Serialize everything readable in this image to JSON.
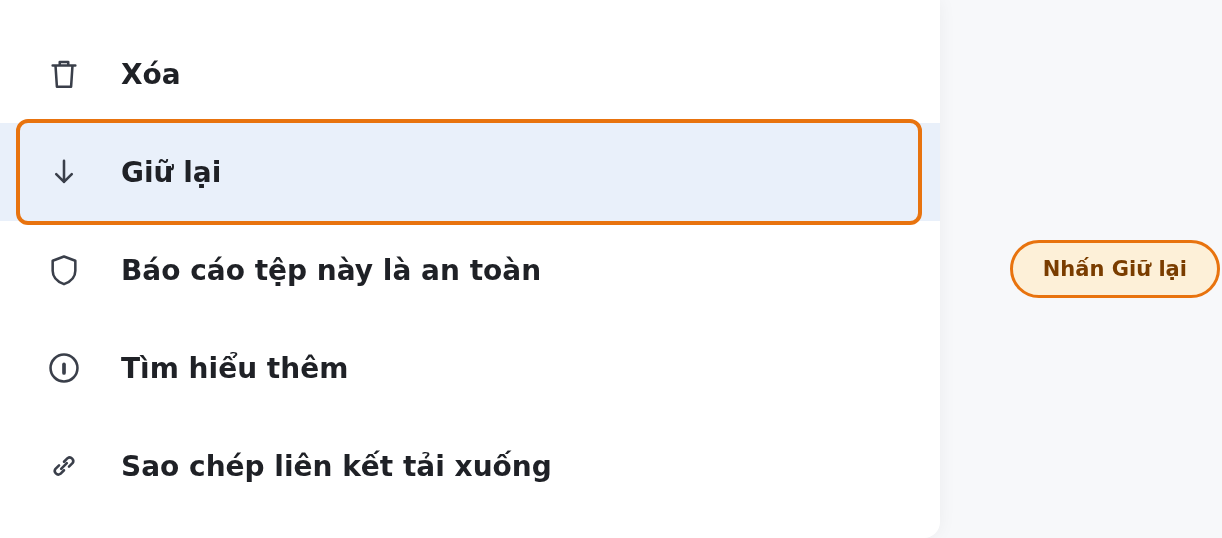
{
  "menu": {
    "items": [
      {
        "kind": "trash",
        "label": "Xóa",
        "selected": false
      },
      {
        "kind": "arrow-down",
        "label": "Giữ lại",
        "selected": true
      },
      {
        "kind": "shield",
        "label": "Báo cáo tệp này là an toàn",
        "selected": false
      },
      {
        "kind": "info",
        "label": "Tìm hiểu thêm",
        "selected": false
      },
      {
        "kind": "link",
        "label": "Sao chép liên kết tải xuống",
        "selected": false
      }
    ]
  },
  "callout": {
    "text": "Nhấn Giữ lại"
  }
}
